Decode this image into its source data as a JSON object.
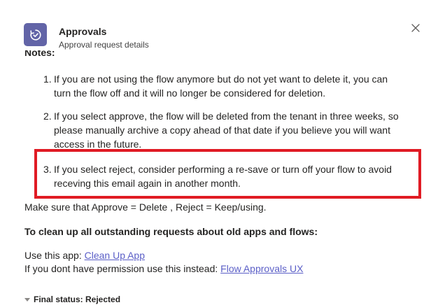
{
  "header": {
    "title": "Approvals",
    "subtitle": "Approval request details"
  },
  "icons": {
    "app": "approvals-icon",
    "close": "close-icon",
    "caret": "caret-down-icon"
  },
  "colors": {
    "brand": "#6264a7",
    "link": "#5b5fc7",
    "highlight": "#e01b24"
  },
  "body": {
    "notes_heading": "Notes:",
    "notes": [
      {
        "num": "1.",
        "lines": [
          "If you are not using the flow anymore but do not yet want to delete it, you can",
          "turn the flow off and it will no longer be considered for deletion."
        ]
      },
      {
        "num": "2.",
        "lines": [
          "If you select approve, the flow will be deleted from the tenant in three weeks, so",
          "please manually archive a copy ahead of that date if you believe you will want",
          "access in the future."
        ]
      },
      {
        "num": "3.",
        "lines": [
          "If you select reject, consider performing a re-save or turn off your flow to avoid",
          "receving this email again in another month."
        ]
      }
    ],
    "make_sure": "Make sure that Approve = Delete , Reject = Keep/using.",
    "cleanup_heading": "To clean up all outstanding requests about old apps and flows:",
    "use_app_prefix": "Use this app: ",
    "use_app_link": "Clean Up App",
    "no_perm_prefix": "If you dont have permission use this instead: ",
    "no_perm_link": "Flow Approvals UX"
  },
  "final_status": "Final status: Rejected"
}
